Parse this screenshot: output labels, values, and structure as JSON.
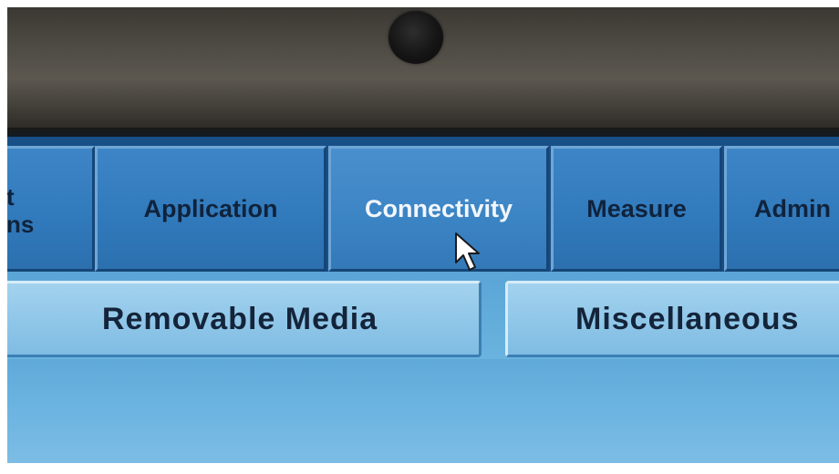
{
  "main_tabs": [
    {
      "label_line1": "t",
      "label_line2": "ns",
      "active": false
    },
    {
      "label": "Application",
      "active": false
    },
    {
      "label": "Connectivity",
      "active": true
    },
    {
      "label": "Measure",
      "active": false
    },
    {
      "label": "Admin",
      "active": false
    }
  ],
  "sub_tabs": [
    {
      "label": "Removable Media"
    },
    {
      "label": "Miscellaneous"
    }
  ],
  "cursor": {
    "icon": "arrow-pointer-icon"
  },
  "colors": {
    "tab_bar": "#184f86",
    "tab": "#3079bb",
    "active_tab_text": "#f2f6fb",
    "subtab": "#8fc6e8",
    "bezel": "#4e4b44"
  }
}
